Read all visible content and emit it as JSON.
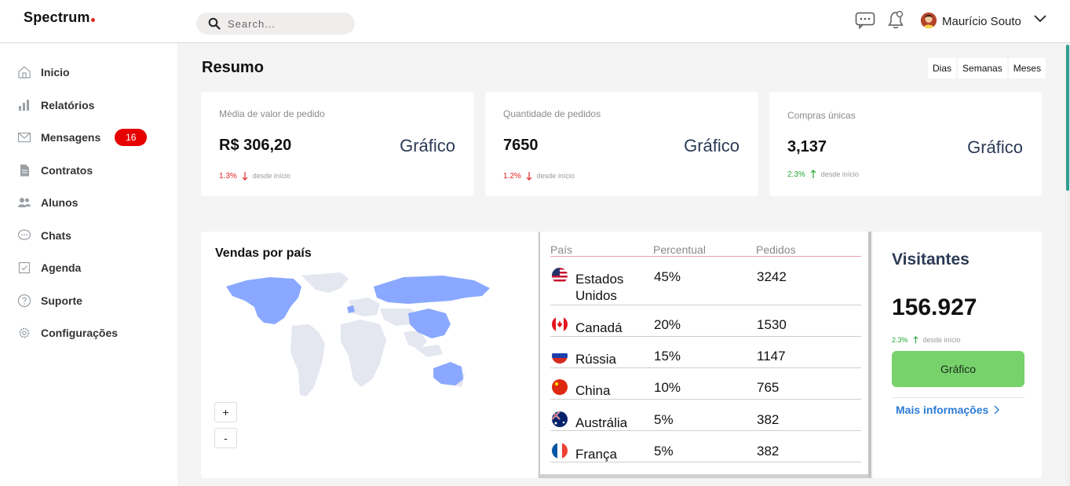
{
  "app": {
    "logo": "Spectrum"
  },
  "search": {
    "placeholder": "Search..."
  },
  "user": {
    "name": "Maurício Souto"
  },
  "sidebar": {
    "items": [
      {
        "label": "Inicio",
        "icon": "home-icon"
      },
      {
        "label": "Relatórios",
        "icon": "bar-chart-icon"
      },
      {
        "label": "Mensagens",
        "icon": "mail-icon",
        "badge": "16"
      },
      {
        "label": "Contratos",
        "icon": "document-icon"
      },
      {
        "label": "Alunos",
        "icon": "users-icon"
      },
      {
        "label": "Chats",
        "icon": "chat-bubble-icon"
      },
      {
        "label": "Agenda",
        "icon": "calendar-check-icon"
      },
      {
        "label": "Suporte",
        "icon": "help-circle-icon"
      },
      {
        "label": "Configurações",
        "icon": "gear-icon"
      }
    ]
  },
  "main": {
    "title": "Resumo",
    "ranges": [
      "Dias",
      "Semanas",
      "Meses"
    ]
  },
  "stats": [
    {
      "label": "Média de valor de pedido",
      "value": "R$ 306,20",
      "graph": "Gráfico",
      "pct": "1.3%",
      "direction": "down",
      "since": "desde início"
    },
    {
      "label": "Quantidade de pedidos",
      "value": "7650",
      "graph": "Gráfico",
      "pct": "1.2%",
      "direction": "down",
      "since": "desde início"
    },
    {
      "label": "Compras únicas",
      "value": "3,137",
      "graph": "Gráfico",
      "pct": "2.3%",
      "direction": "up",
      "since": "desde início"
    }
  ],
  "sales": {
    "title": "Vendas por país",
    "zoom_in": "+",
    "zoom_out": "-",
    "headers": {
      "country": "País",
      "percent": "Percentual",
      "orders": "Pedidos"
    },
    "rows": [
      {
        "country": "Estados Unidos",
        "percent": "45%",
        "orders": "3242",
        "flag": "us-flag-icon"
      },
      {
        "country": "Canadá",
        "percent": "20%",
        "orders": "1530",
        "flag": "canada-flag-icon"
      },
      {
        "country": "Rússia",
        "percent": "15%",
        "orders": "1147",
        "flag": "russia-flag-icon"
      },
      {
        "country": "China",
        "percent": "10%",
        "orders": "765",
        "flag": "china-flag-icon"
      },
      {
        "country": "Austrália",
        "percent": "5%",
        "orders": "382",
        "flag": "australia-flag-icon"
      },
      {
        "country": "França",
        "percent": "5%",
        "orders": "382",
        "flag": "france-flag-icon"
      }
    ]
  },
  "visitors": {
    "title": "Visitantes",
    "value": "156.927",
    "pct": "2.3%",
    "since": "desde início",
    "button": "Gráfico",
    "more": "Mais informações"
  },
  "colors": {
    "accent_navy": "#2b3a55",
    "down": "#e02424",
    "up": "#22a634",
    "badge": "#e60000",
    "button_green": "#77d26c",
    "link_blue": "#2b7bd6",
    "map_highlight": "#8aa8ff",
    "map_base": "#e4e6f0"
  }
}
